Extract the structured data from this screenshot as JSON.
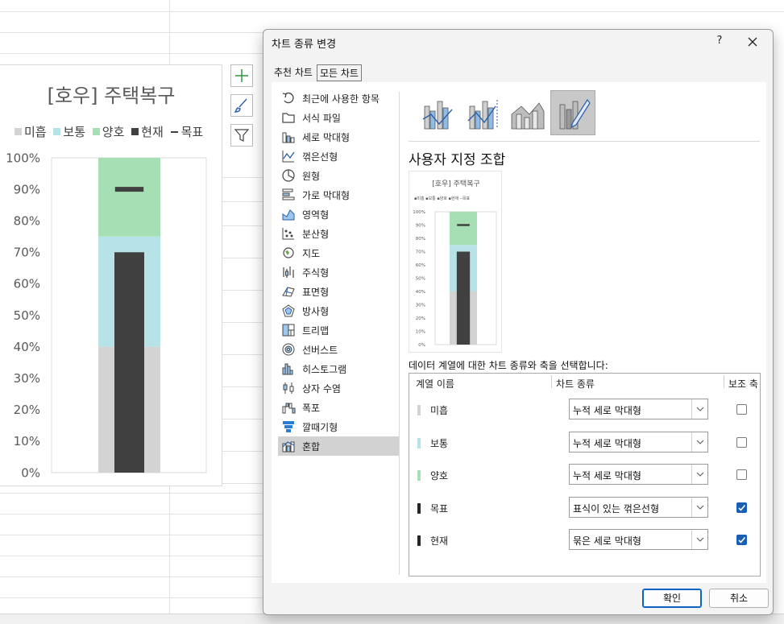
{
  "background_chart": {
    "title": "[호우] 주택복구",
    "legend": [
      {
        "label": "미흡",
        "color": "#d3d3d3",
        "kind": "box"
      },
      {
        "label": "보통",
        "color": "#b7e3e8",
        "kind": "box"
      },
      {
        "label": "양호",
        "color": "#a6dfb3",
        "kind": "box"
      },
      {
        "label": "현재",
        "color": "#404040",
        "kind": "box"
      },
      {
        "label": "목표",
        "color": "#404040",
        "kind": "dash"
      }
    ]
  },
  "chart_data": {
    "type": "bar",
    "title": "[호우] 주택복구",
    "xlabel": "",
    "ylabel": "",
    "ylim": [
      0,
      1
    ],
    "yticks": [
      "0%",
      "10%",
      "20%",
      "30%",
      "40%",
      "50%",
      "60%",
      "70%",
      "80%",
      "90%",
      "100%"
    ],
    "categories": [
      ""
    ],
    "series": [
      {
        "name": "미흡",
        "values": [
          0.4
        ],
        "stacked": true,
        "color": "#d3d3d3"
      },
      {
        "name": "보통",
        "values": [
          0.35
        ],
        "stacked": true,
        "color": "#b7e3e8"
      },
      {
        "name": "양호",
        "values": [
          0.25
        ],
        "stacked": true,
        "color": "#a6dfb3"
      },
      {
        "name": "현재",
        "values": [
          0.7
        ],
        "type": "bar",
        "axis": "secondary",
        "color": "#404040"
      },
      {
        "name": "목표",
        "values": [
          0.9
        ],
        "type": "marker",
        "axis": "secondary",
        "color": "#404040"
      }
    ],
    "legend": "top",
    "grid": false
  },
  "dialog": {
    "title": "차트 종류 변경",
    "help": "?",
    "tabs": [
      "추천 차트",
      "모든 차트"
    ],
    "chart_types": [
      {
        "label": "최근에 사용한 항목",
        "icon": "recent-icon"
      },
      {
        "label": "서식 파일",
        "icon": "folder-icon"
      },
      {
        "label": "세로 막대형",
        "icon": "column-chart-icon"
      },
      {
        "label": "꺾은선형",
        "icon": "line-chart-icon"
      },
      {
        "label": "원형",
        "icon": "pie-chart-icon"
      },
      {
        "label": "가로 막대형",
        "icon": "bar-chart-icon"
      },
      {
        "label": "영역형",
        "icon": "area-chart-icon"
      },
      {
        "label": "분산형",
        "icon": "scatter-chart-icon"
      },
      {
        "label": "지도",
        "icon": "map-chart-icon"
      },
      {
        "label": "주식형",
        "icon": "stock-chart-icon"
      },
      {
        "label": "표면형",
        "icon": "surface-chart-icon"
      },
      {
        "label": "방사형",
        "icon": "radar-chart-icon"
      },
      {
        "label": "트리맵",
        "icon": "treemap-chart-icon"
      },
      {
        "label": "선버스트",
        "icon": "sunburst-chart-icon"
      },
      {
        "label": "히스토그램",
        "icon": "histogram-chart-icon"
      },
      {
        "label": "상자 수염",
        "icon": "box-whisker-chart-icon"
      },
      {
        "label": "폭포",
        "icon": "waterfall-chart-icon"
      },
      {
        "label": "깔때기형",
        "icon": "funnel-chart-icon"
      },
      {
        "label": "혼합",
        "icon": "combo-chart-icon"
      }
    ],
    "selected_type": "혼합",
    "combo_heading": "사용자 지정 조합",
    "preview": {
      "title": "[호우] 주택복구",
      "legend": "▪미흡 ▪보통 ▪양호 ▪현재 ‒목표",
      "yticks": [
        "0%",
        "10%",
        "20%",
        "30%",
        "40%",
        "50%",
        "60%",
        "70%",
        "80%",
        "90%",
        "100%"
      ]
    },
    "series_caption": "데이터 계열에 대한 차트 종류와 축을 선택합니다:",
    "series_headers": {
      "name": "계열 이름",
      "type": "차트 종류",
      "axis": "보조 축"
    },
    "series_rows": [
      {
        "name": "미흡",
        "color": "#d3d3d3",
        "chart_type": "누적 세로 막대형",
        "secondary": false
      },
      {
        "name": "보통",
        "color": "#b7e3e8",
        "chart_type": "누적 세로 막대형",
        "secondary": false
      },
      {
        "name": "양호",
        "color": "#a6dfb3",
        "chart_type": "누적 세로 막대형",
        "secondary": false
      },
      {
        "name": "목표",
        "color": "#262626",
        "chart_type": "표식이 있는 꺾은선형",
        "secondary": true
      },
      {
        "name": "현재",
        "color": "#262626",
        "chart_type": "묶은 세로 막대형",
        "secondary": true
      }
    ],
    "ok_label": "확인",
    "cancel_label": "취소"
  },
  "colors": {
    "accent": "#1a5fb4",
    "selected_bg": "#d2d2d2"
  }
}
